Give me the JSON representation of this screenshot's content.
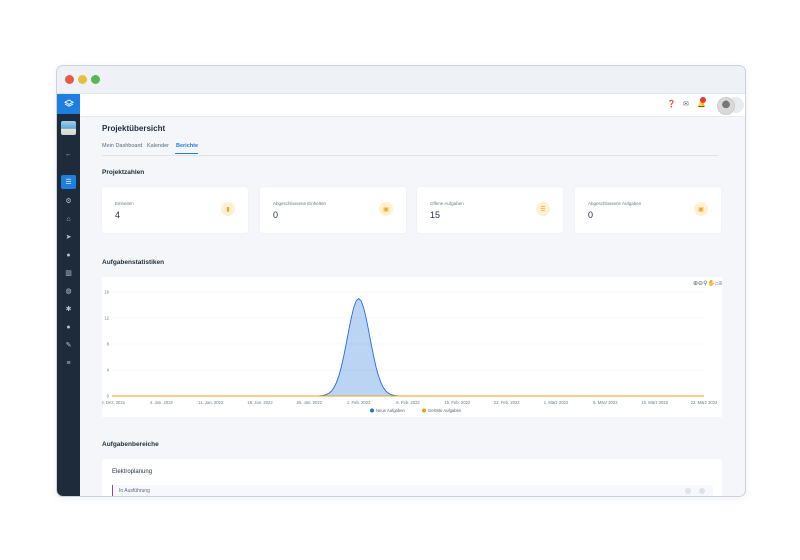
{
  "page": {
    "title": "Projektübersicht",
    "tabs": [
      {
        "label": "Mein Dashboard"
      },
      {
        "label": "Kalender"
      },
      {
        "label": "Berichte"
      }
    ]
  },
  "sidebar": {
    "icons": [
      "layers-icon",
      "project-thumbnail",
      "arrow-left-icon",
      "list-icon",
      "settings-icon",
      "home-icon",
      "send-icon",
      "user-icon",
      "chart-icon",
      "globe-icon",
      "star-icon",
      "bell-icon",
      "wrench-icon",
      "menu-icon"
    ]
  },
  "topbar": {
    "icons": [
      "help-icon",
      "mail-icon",
      "notifications-icon",
      "avatar",
      "chevron-down-icon"
    ]
  },
  "sections": {
    "project_numbers": "Projektzahlen",
    "task_stats": "Aufgabenstatistiken",
    "task_areas": "Aufgabenbereiche"
  },
  "cards": [
    {
      "label": "Einheiten",
      "value": "4"
    },
    {
      "label": "Abgeschlossene Einheiten",
      "value": "0"
    },
    {
      "label": "Offene Aufgaben",
      "value": "15"
    },
    {
      "label": "Abgeschlossene Aufgaben",
      "value": "0"
    }
  ],
  "task_areas": {
    "title": "Elektroplanung",
    "row_label": "In Ausführung"
  },
  "colors": {
    "accent": "#1e7fe0",
    "sidebar": "#1d2b3a",
    "card_icon_bg": "#fdf1d3",
    "card_icon_fg": "#f0a21b",
    "series_new": "#1e6fd9",
    "series_done": "#e8a317"
  },
  "chart_data": {
    "type": "area",
    "x": [
      "28. Dez. 2021",
      "4. Jan. 2022",
      "11. Jan. 2022",
      "18. Jan. 2022",
      "25. Jan. 2022",
      "1. Feb. 2022",
      "8. Feb. 2022",
      "15. Feb. 2022",
      "22. Feb. 2022",
      "1. März 2022",
      "8. März 2022",
      "15. März 2022",
      "22. März 2022"
    ],
    "yticks": [
      0,
      4,
      8,
      12,
      16
    ],
    "ylim": [
      0,
      16
    ],
    "series": [
      {
        "name": "Neue Aufgaben",
        "values": [
          0,
          0,
          0,
          0,
          0,
          15,
          0,
          0,
          0,
          0,
          0,
          0,
          0
        ]
      },
      {
        "name": "Gelöste Aufgaben",
        "values": [
          0,
          0,
          0,
          0,
          0,
          0,
          0,
          0,
          0,
          0,
          0,
          0,
          0
        ]
      }
    ],
    "legend": "bottom",
    "grid": true
  }
}
